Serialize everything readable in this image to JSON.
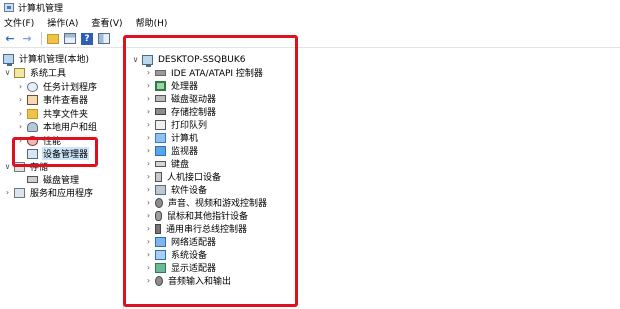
{
  "window": {
    "title": "计算机管理"
  },
  "menu": [
    "文件(F)",
    "操作(A)",
    "查看(V)",
    "帮助(H)"
  ],
  "toolbar": {
    "buttons": [
      "back-arrow-icon",
      "forward-arrow-icon",
      "up-folder-icon",
      "properties-icon",
      "help-icon",
      "show-hide-pane-icon"
    ]
  },
  "left_tree": {
    "root": "计算机管理(本地)",
    "system_tools": "系统工具",
    "task_scheduler": "任务计划程序",
    "event_viewer": "事件查看器",
    "shared_folders": "共享文件夹",
    "local_users": "本地用户和组",
    "performance": "性能",
    "device_manager": "设备管理器",
    "storage": "存储",
    "disk_management": "磁盘管理",
    "services_apps": "服务和应用程序"
  },
  "devices": {
    "computer_name": "DESKTOP-SSQBUK6",
    "categories": [
      "IDE ATA/ATAPI 控制器",
      "处理器",
      "磁盘驱动器",
      "存储控制器",
      "打印队列",
      "计算机",
      "监视器",
      "键盘",
      "人机接口设备",
      "软件设备",
      "声音、视频和游戏控制器",
      "鼠标和其他指针设备",
      "通用串行总线控制器",
      "网络适配器",
      "系统设备",
      "显示适配器",
      "音频输入和输出"
    ]
  },
  "colors": {
    "highlight": "#e0111c",
    "selection": "#cce4f7"
  }
}
